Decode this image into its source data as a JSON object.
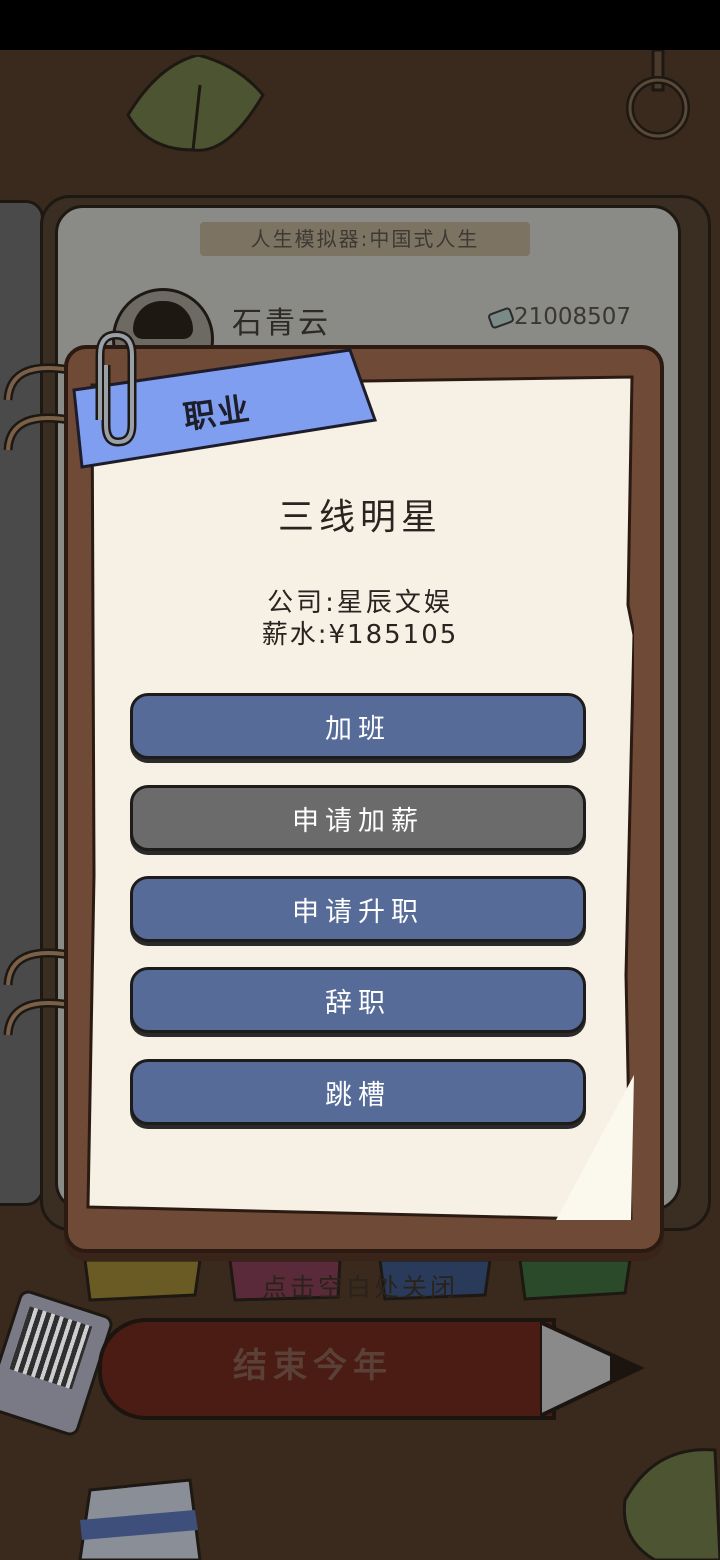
{
  "notebook": {
    "title": "人生模拟器:中国式人生",
    "player_name": "石青云",
    "money": "21008507"
  },
  "modal": {
    "tag": "职业",
    "job_title": "三线明星",
    "company_label": "公司:",
    "company": "星辰文娱",
    "salary_label": "薪水:",
    "salary": "¥185105",
    "actions": [
      {
        "label": "加班",
        "enabled": true
      },
      {
        "label": "申请加薪",
        "enabled": false
      },
      {
        "label": "申请升职",
        "enabled": true
      },
      {
        "label": "辞职",
        "enabled": true
      },
      {
        "label": "跳槽",
        "enabled": true
      }
    ]
  },
  "close_hint": "点击空白处关闭",
  "end_year_button": "结束今年",
  "colors": {
    "button_blue": "#566b98",
    "button_disabled": "#6b6b6b",
    "tag_blue": "#7f9ef0",
    "paper": "#f6f1e4",
    "frame": "#6e4a37"
  }
}
